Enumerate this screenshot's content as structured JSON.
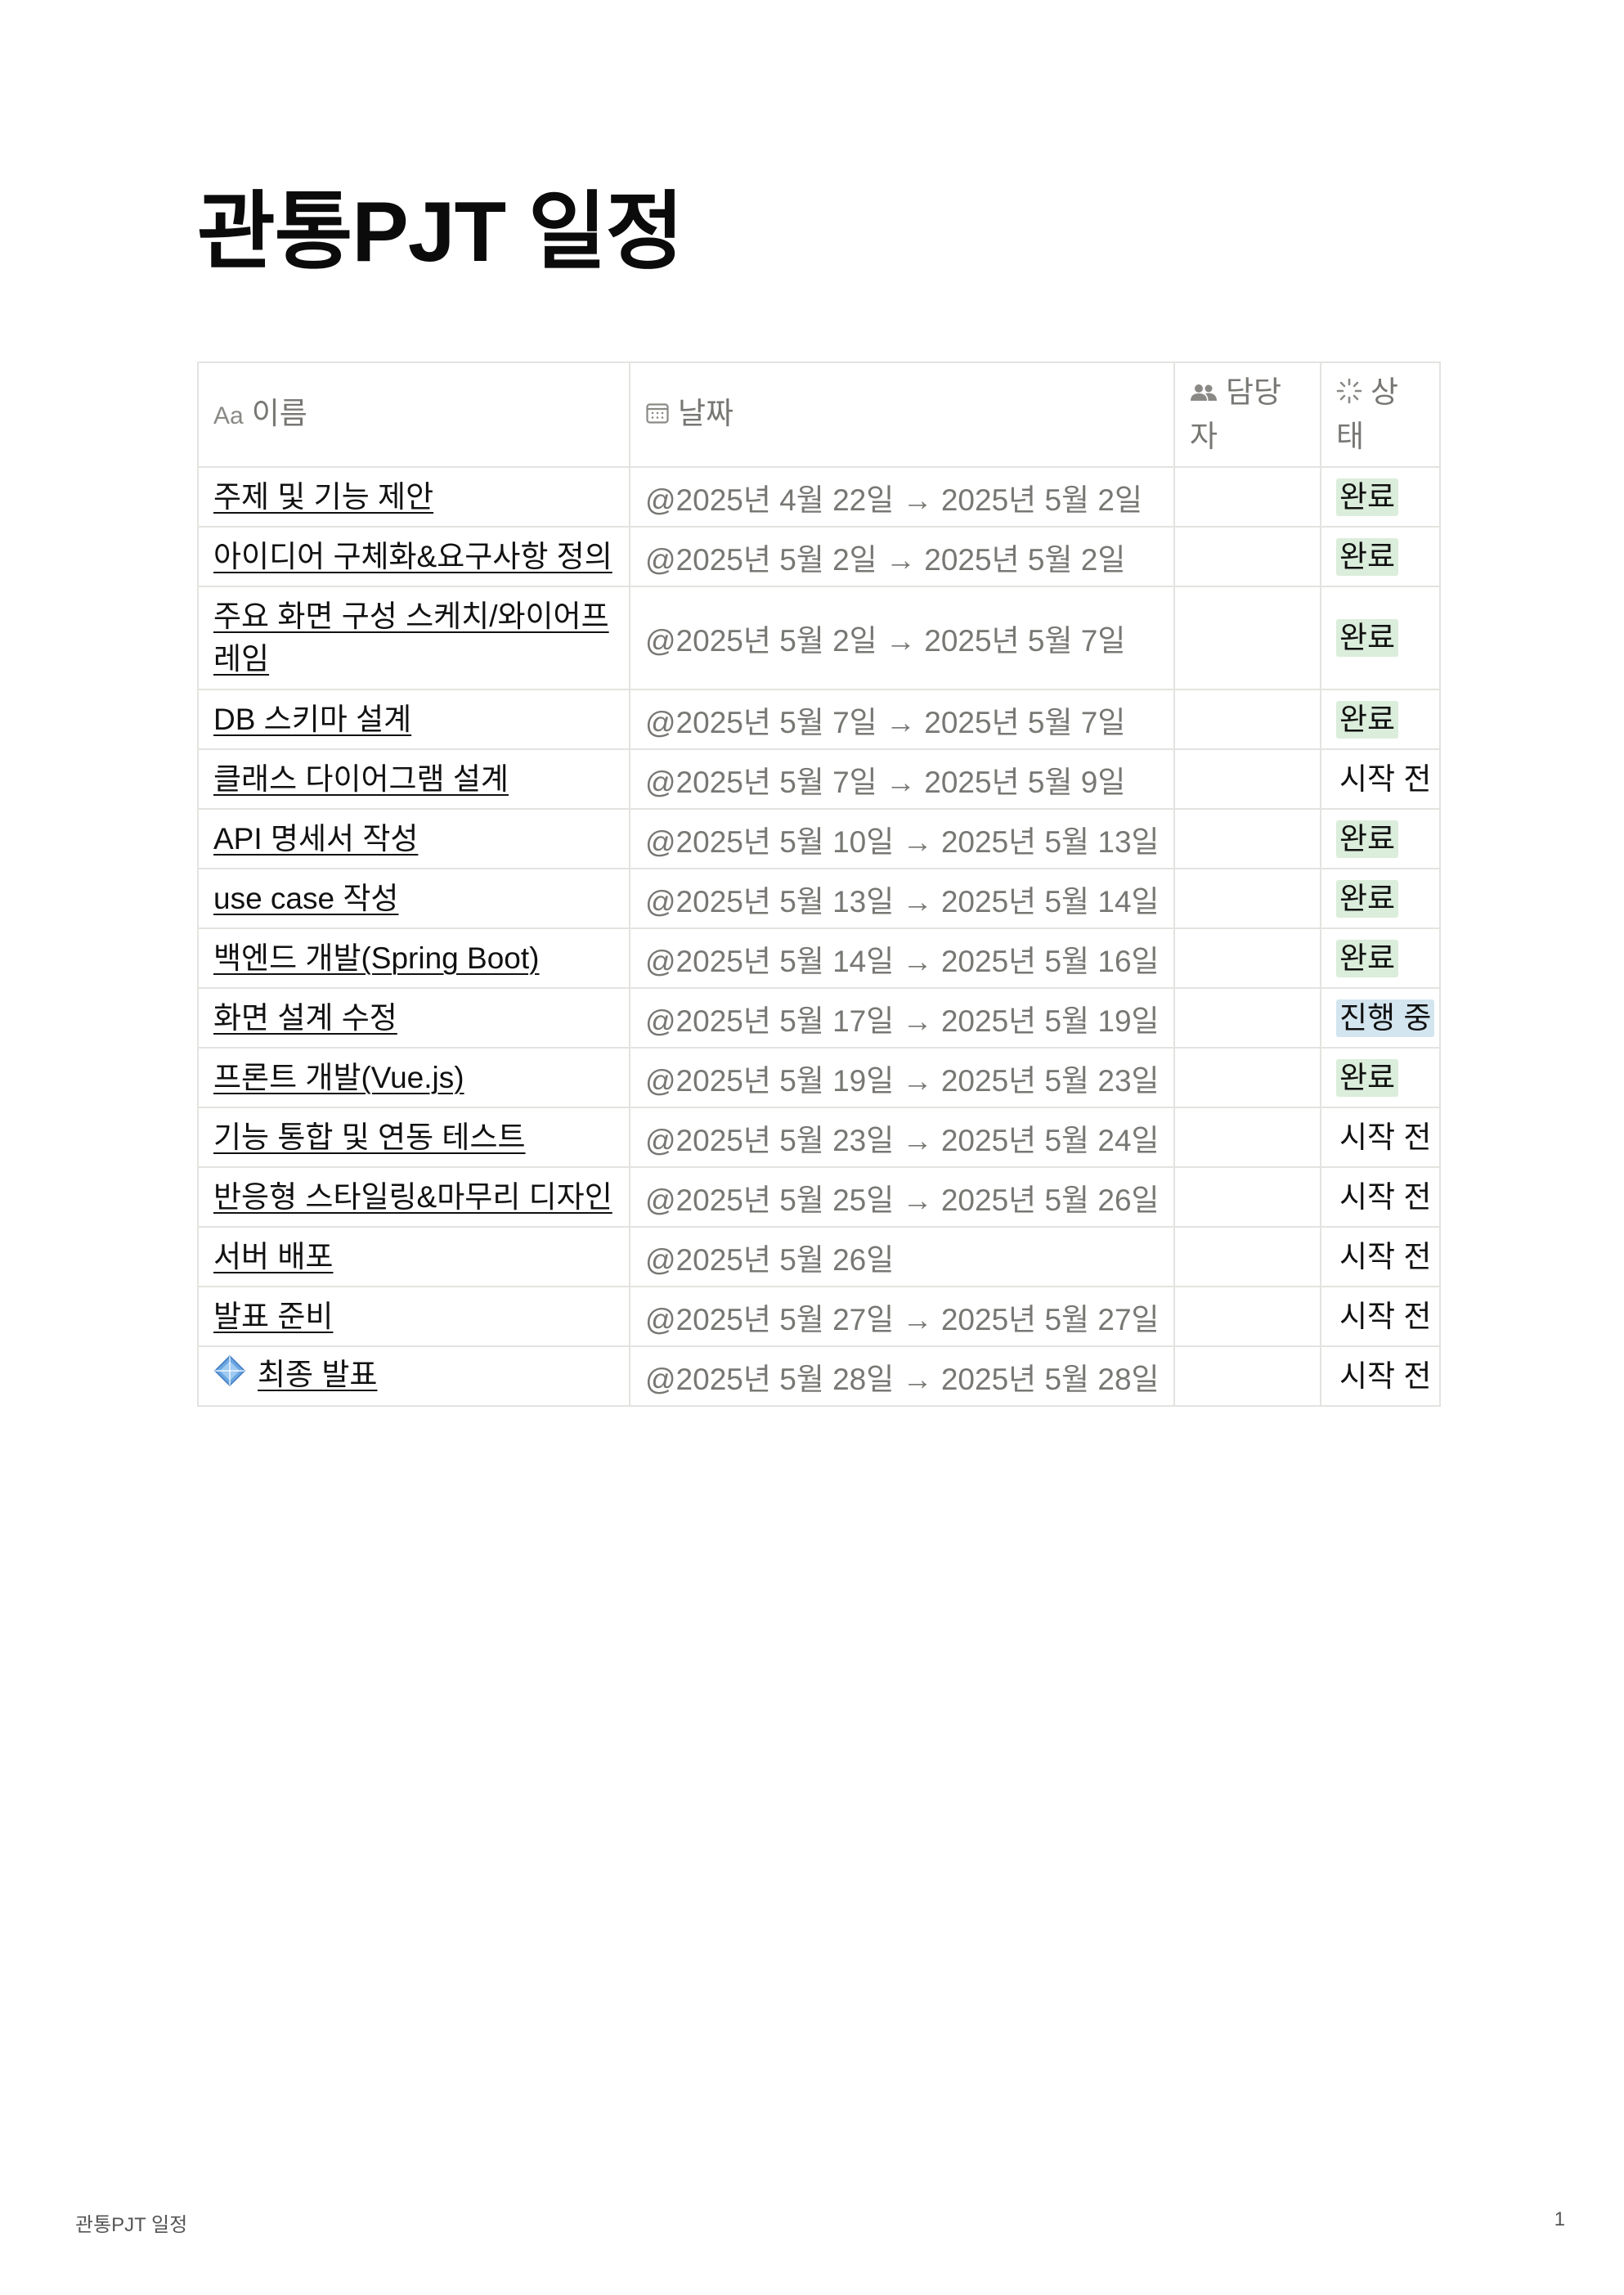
{
  "page_title": "관통PJT 일정",
  "table": {
    "headers": {
      "name": {
        "icon": "text-aa-icon",
        "icon_text": "Aa",
        "label": "이름"
      },
      "date": {
        "icon": "calendar-icon",
        "label": "날짜"
      },
      "assignee": {
        "icon": "people-icon",
        "label": "담당자"
      },
      "status": {
        "icon": "loading-spinner-icon",
        "label": "상태"
      }
    },
    "status_colors": {
      "완료": "#dbeddb",
      "진행 중": "#d3e5ef",
      "시작 전": "transparent"
    },
    "rows": [
      {
        "name": "주제 및 기능 제안",
        "date": "@2025년 4월 22일 → 2025년 5월 2일",
        "assignee": "",
        "status": "완료"
      },
      {
        "name": "아이디어 구체화&요구사항 정의",
        "date": "@2025년 5월 2일 → 2025년 5월 2일",
        "assignee": "",
        "status": "완료"
      },
      {
        "name": "주요 화면 구성 스케치/와이어프레임",
        "date": "@2025년 5월 2일 → 2025년 5월 7일",
        "assignee": "",
        "status": "완료"
      },
      {
        "name": "DB 스키마 설계",
        "date": "@2025년 5월 7일 → 2025년 5월 7일",
        "assignee": "",
        "status": "완료"
      },
      {
        "name": "클래스 다이어그램 설계",
        "date": "@2025년 5월 7일 → 2025년 5월 9일",
        "assignee": "",
        "status": "시작 전"
      },
      {
        "name": "API 명세서 작성",
        "date": "@2025년 5월 10일 → 2025년 5월 13일",
        "assignee": "",
        "status": "완료"
      },
      {
        "name": "use case 작성",
        "date": "@2025년 5월 13일 → 2025년 5월 14일",
        "assignee": "",
        "status": "완료"
      },
      {
        "name": "백엔드 개발(Spring Boot)",
        "date": "@2025년 5월 14일 → 2025년 5월 16일",
        "assignee": "",
        "status": "완료"
      },
      {
        "name": "화면 설계 수정",
        "date": "@2025년 5월 17일 → 2025년 5월 19일",
        "assignee": "",
        "status": "진행 중"
      },
      {
        "name": "프론트 개발(Vue.js)",
        "date": "@2025년 5월 19일 → 2025년 5월 23일",
        "assignee": "",
        "status": "완료"
      },
      {
        "name": "기능 통합 및 연동 테스트",
        "date": "@2025년 5월 23일 → 2025년 5월 24일",
        "assignee": "",
        "status": "시작 전"
      },
      {
        "name": "반응형 스타일링&마무리 디자인",
        "date": "@2025년 5월 25일 → 2025년 5월 26일",
        "assignee": "",
        "status": "시작 전"
      },
      {
        "name": "서버 배포",
        "date": "@2025년 5월 26일",
        "assignee": "",
        "status": "시작 전"
      },
      {
        "name": "발표 준비",
        "date": "@2025년 5월 27일 → 2025년 5월 27일",
        "assignee": "",
        "status": "시작 전"
      },
      {
        "name": "최종 발표",
        "icon": "blue-diamond-icon",
        "date": "@2025년 5월 28일 → 2025년 5월 28일",
        "assignee": "",
        "status": "시작 전"
      }
    ]
  },
  "footer": {
    "title": "관통PJT 일정",
    "page_number": "1"
  }
}
